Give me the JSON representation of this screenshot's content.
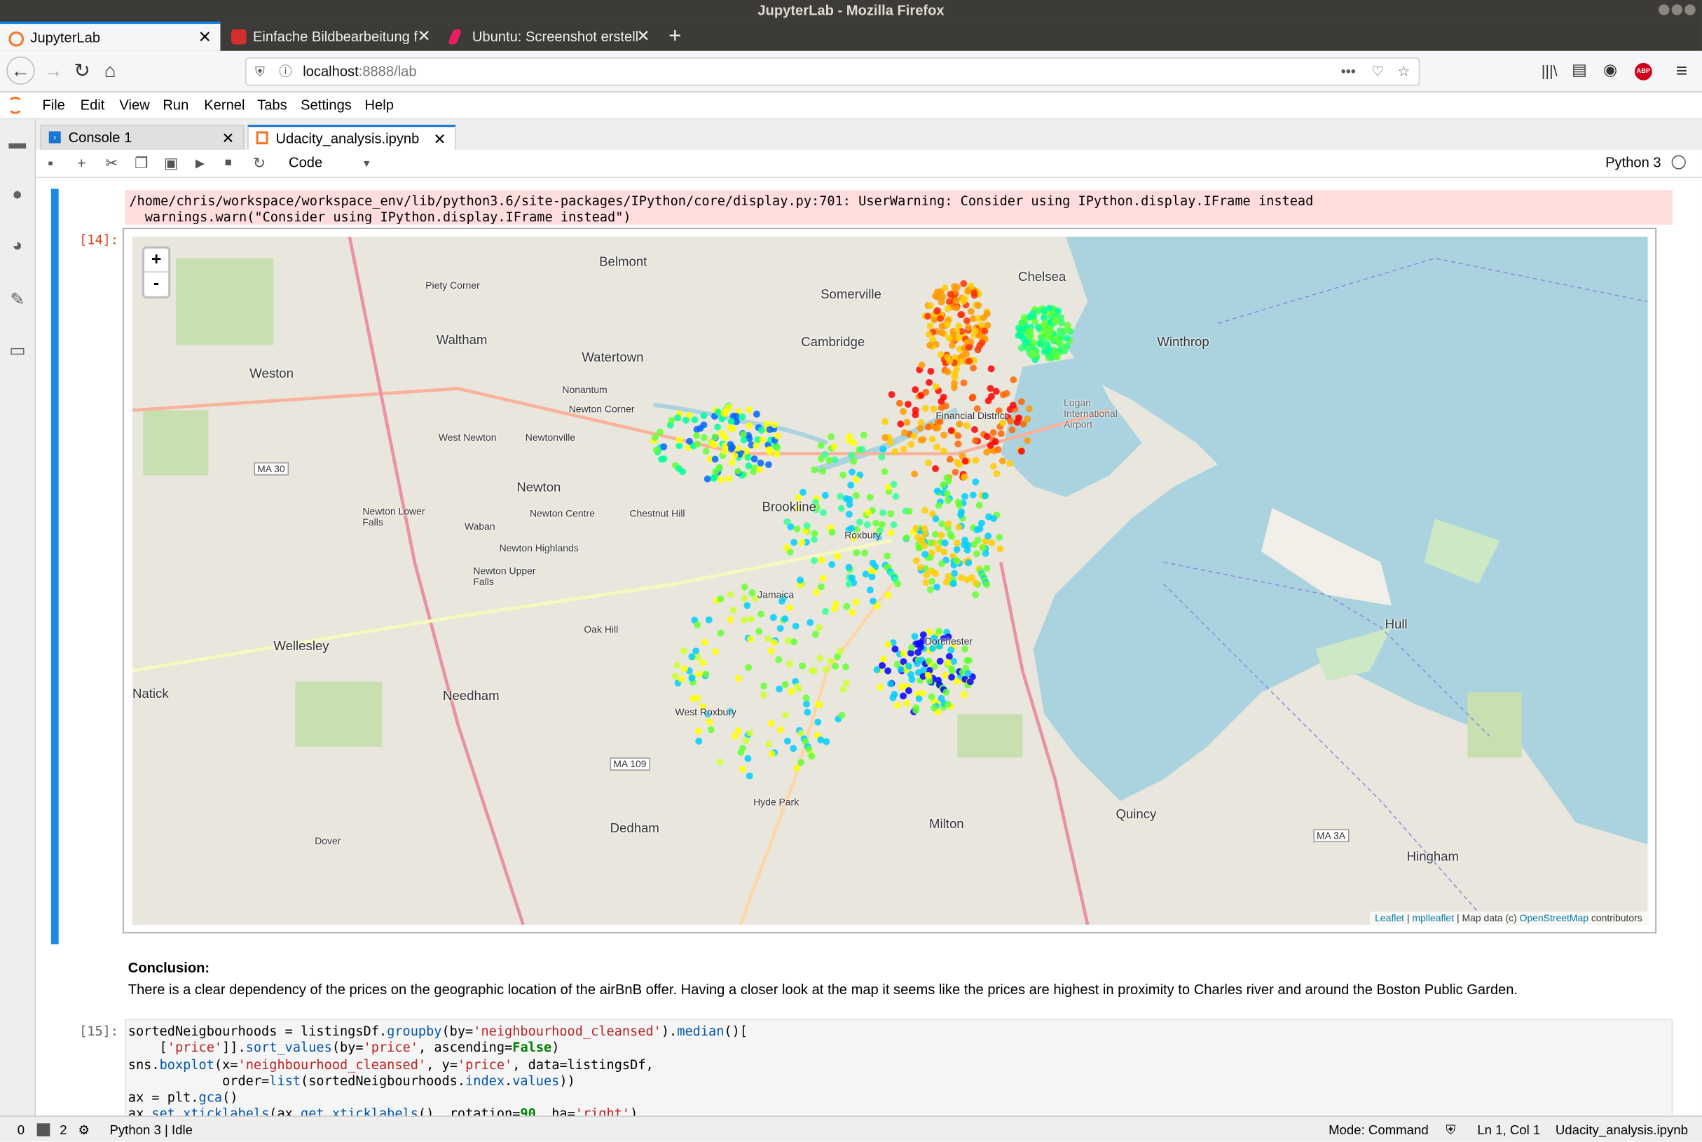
{
  "window_title": "JupyterLab - Mozilla Firefox",
  "browser_tabs": [
    {
      "label": "JupyterLab",
      "active": true
    },
    {
      "label": "Einfache Bildbearbeitung f",
      "active": false
    },
    {
      "label": "Ubuntu: Screenshot erstell",
      "active": false
    }
  ],
  "url": {
    "host": "localhost",
    "path": ":8888/lab"
  },
  "menu": [
    "File",
    "Edit",
    "View",
    "Run",
    "Kernel",
    "Tabs",
    "Settings",
    "Help"
  ],
  "doc_tabs": [
    {
      "label": "Console 1",
      "active": false
    },
    {
      "label": "Udacity_analysis.ipynb",
      "active": true
    }
  ],
  "toolbar": {
    "cell_type": "Code",
    "kernel": "Python 3"
  },
  "cells": {
    "out14_prompt": "[14]:",
    "stderr_line1": "/home/chris/workspace/workspace_env/lib/python3.6/site-packages/IPython/core/display.py:701: UserWarning: Consider using IPython.display.IFrame instead",
    "stderr_line2": "  warnings.warn(\"Consider using IPython.display.IFrame instead\")",
    "conclusion_heading": "Conclusion:",
    "conclusion_text": "There is a clear dependency of the prices on the geographic location of the airBnB offer. Having a closer look at the map it seems like the prices are highest in proximity to Charles river and around the Boston Public Garden.",
    "in15_prompt": "[15]:"
  },
  "map": {
    "zoom_in": "+",
    "zoom_out": "-",
    "attribution": {
      "leaflet": "Leaflet",
      "sep1": " | ",
      "mplleaflet": "mplleaflet",
      "mid": " | Map data (c) ",
      "osm": "OpenStreetMap",
      "end": " contributors"
    },
    "places": [
      "Belmont",
      "Somerville",
      "Chelsea",
      "Piety Corner",
      "Waltham",
      "Watertown",
      "Cambridge",
      "Winthrop",
      "Weston",
      "Nonantum",
      "Newton Corner",
      "West Newton",
      "Newtonville",
      "Newton",
      "Brookline",
      "Newton Lower Falls",
      "Waban",
      "Newton Centre",
      "Chestnut Hill",
      "Newton Highlands",
      "Newton Upper Falls",
      "Oak Hill",
      "Wellesley",
      "Needham",
      "Natick",
      "West Roxbury",
      "Roxbury",
      "Jamaica",
      "Dorchester",
      "Hyde Park",
      "Dedham",
      "Milton",
      "Quincy",
      "Hull",
      "Hingham",
      "Dover",
      "Logan International Airport",
      "Financial District",
      "MA 30",
      "MA 109",
      "MA 3A"
    ]
  },
  "status": {
    "left1": "0",
    "left2": "2",
    "kernel": "Python 3 | Idle",
    "mode": "Mode: Command",
    "pos": "Ln 1, Col 1",
    "file": "Udacity_analysis.ipynb"
  }
}
